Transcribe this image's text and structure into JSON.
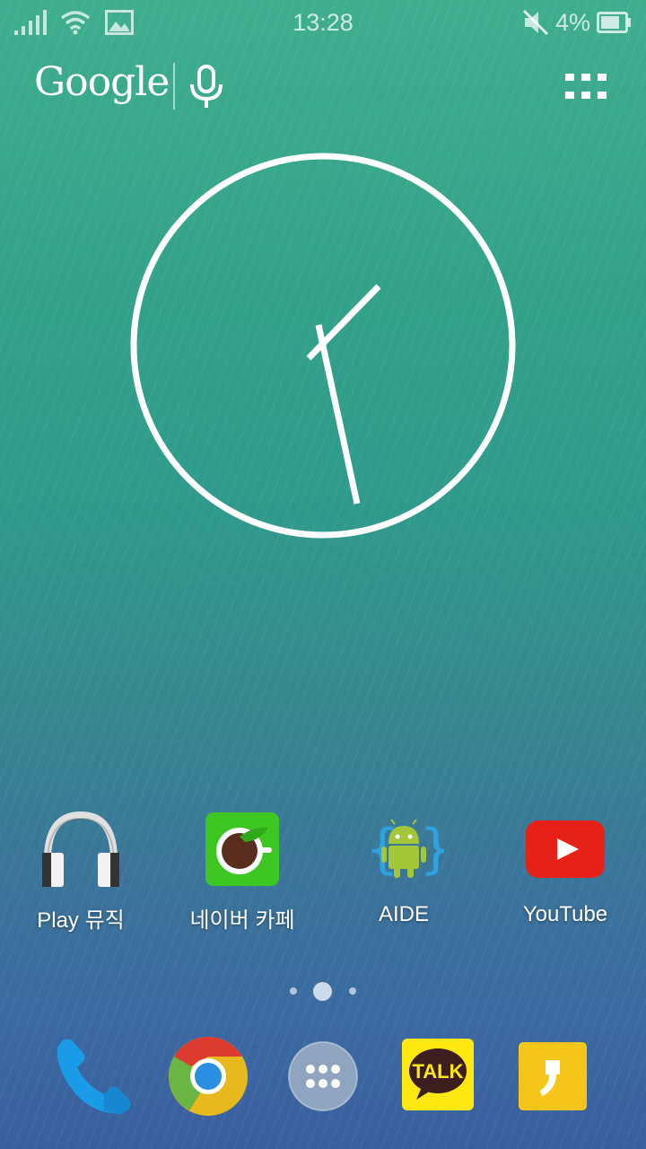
{
  "status_bar": {
    "time": "13:28",
    "battery_percent": "4%",
    "icons": [
      "signal-icon",
      "wifi-icon",
      "gallery-notification-icon",
      "mute-icon",
      "battery-icon"
    ]
  },
  "search": {
    "logo": "Google",
    "icons": [
      "mic-icon",
      "apps-grid-icon"
    ]
  },
  "clock_widget": {
    "time": "13:28"
  },
  "apps": [
    {
      "label": "Play 뮤직",
      "icon": "headphones-icon"
    },
    {
      "label": "네이버 카페",
      "icon": "naver-cafe-icon"
    },
    {
      "label": "AIDE",
      "icon": "android-braces-icon"
    },
    {
      "label": "YouTube",
      "icon": "youtube-icon"
    }
  ],
  "page_indicator": {
    "pages": 3,
    "current": 2
  },
  "dock": [
    {
      "icon": "phone-icon"
    },
    {
      "icon": "chrome-icon"
    },
    {
      "icon": "app-drawer-icon"
    },
    {
      "icon": "kakaotalk-icon",
      "text": "TALK"
    },
    {
      "icon": "kakaostory-icon"
    }
  ],
  "colors": {
    "youtube_red": "#e62117",
    "kakao_yellow": "#ffe812",
    "naver_green": "#3ec623",
    "android_green": "#a4c639"
  }
}
